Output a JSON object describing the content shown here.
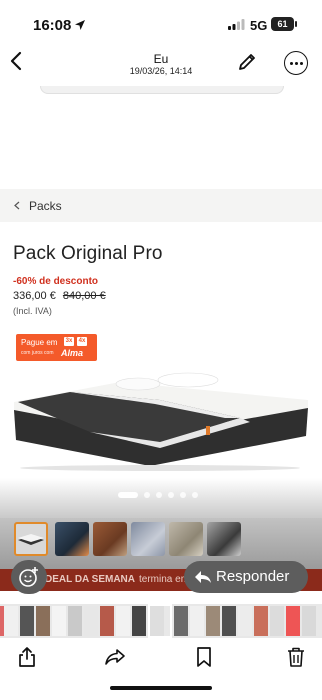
{
  "status_bar": {
    "time": "16:08",
    "network": "5G",
    "battery": "61"
  },
  "nav": {
    "title": "Eu",
    "subtitle": "19/03/26, 14:14"
  },
  "breadcrumb": {
    "label": "Packs"
  },
  "product": {
    "title": "Pack Original Pro",
    "discount": "-60% de desconto",
    "price": "336,00 €",
    "old_price": "840,00 €",
    "vat_note": "(Incl. IVA)"
  },
  "alma_badge": {
    "prefix": "Pague em",
    "option_3": "3x",
    "option_4": "4x",
    "small": "com juros com",
    "brand": "Alma"
  },
  "deal_banner": {
    "bold": "DEAL DA SEMANA",
    "rest": "termina em"
  },
  "reply_button": {
    "label": "Responder"
  },
  "gallery": {
    "active_dot": 0,
    "dot_count": 6,
    "thumb_count": 6
  },
  "icons": {
    "back": "chevron-left-icon",
    "edit": "pencil-icon",
    "more": "ellipsis-circle-icon",
    "share": "share-icon",
    "forward": "forward-icon",
    "bookmark": "bookmark-icon",
    "delete": "trash-icon"
  }
}
